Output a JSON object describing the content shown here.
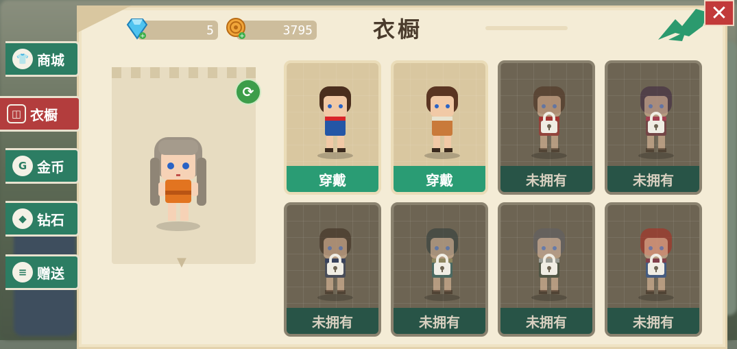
{
  "title": "衣橱",
  "currency": {
    "diamonds": "5",
    "coins": "3795"
  },
  "tabs": [
    {
      "label": "商城",
      "icon": "shirt-icon",
      "active": false
    },
    {
      "label": "衣橱",
      "icon": "wardrobe-icon",
      "active": true
    },
    {
      "label": "金币",
      "icon": "coin-icon",
      "active": false
    },
    {
      "label": "钻石",
      "icon": "diamond-icon",
      "active": false
    },
    {
      "label": "赠送",
      "icon": "gift-icon",
      "active": false
    }
  ],
  "items": [
    {
      "status": "穿戴",
      "owned": true,
      "hair": "#4a2e1e",
      "outfit": "#2456a6",
      "accent": "#d8242a"
    },
    {
      "status": "穿戴",
      "owned": true,
      "hair": "#5a3522",
      "outfit": "#c97a3a",
      "accent": "#e8e4d0"
    },
    {
      "status": "未拥有",
      "owned": false,
      "hair": "#4a2e1e",
      "outfit": "#b02a2a",
      "accent": "#b02a2a"
    },
    {
      "status": "未拥有",
      "owned": false,
      "hair": "#3b2340",
      "outfit": "#7a2d3c",
      "accent": "#c93a5a"
    },
    {
      "status": "未拥有",
      "owned": false,
      "hair": "#3b2a1e",
      "outfit": "#2b3a5e",
      "accent": "#2b3a5e"
    },
    {
      "status": "未拥有",
      "owned": false,
      "hair": "#2b3a3a",
      "outfit": "#2e6e6e",
      "accent": "#c8a060"
    },
    {
      "status": "未拥有",
      "owned": false,
      "hair": "#5e5e66",
      "outfit": "#3a4a3a",
      "accent": "#d6d6d6"
    },
    {
      "status": "未拥有",
      "owned": false,
      "hair": "#b2281e",
      "outfit": "#2456a6",
      "accent": "#b2281e"
    }
  ],
  "colors": {
    "accent_green": "#2a9c74",
    "locked_label": "#285447",
    "active_tab": "#b33d3d",
    "parchment": "#f4ecd6"
  }
}
